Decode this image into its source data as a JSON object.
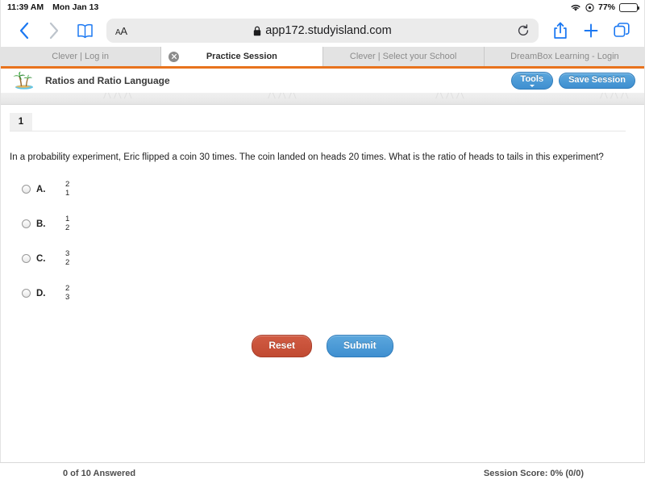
{
  "status_bar": {
    "time": "11:39 AM",
    "date": "Mon Jan 13",
    "battery_percent": "77%",
    "wifi_icon": "wifi-icon",
    "location_icon": "location-icon",
    "battery_icon": "battery-icon"
  },
  "browser": {
    "back_icon": "chevron-left-icon",
    "forward_icon": "chevron-right-icon",
    "bookmarks_icon": "book-icon",
    "text_size_label": "AA",
    "lock_icon": "lock-icon",
    "url": "app172.studyisland.com",
    "reload_icon": "reload-icon",
    "share_icon": "share-icon",
    "new_tab_icon": "plus-icon",
    "tabs_overview_icon": "tabs-icon",
    "tabs": [
      {
        "label": "Clever | Log in",
        "active": false,
        "has_close": false
      },
      {
        "label": "Practice Session",
        "active": true,
        "has_close": true,
        "close_icon": "close-circle-icon"
      },
      {
        "label": "Clever | Select your School",
        "active": false,
        "has_close": false
      },
      {
        "label": "DreamBox Learning - Login",
        "active": false,
        "has_close": false
      }
    ]
  },
  "app": {
    "logo_icon": "palm-island-logo-icon",
    "title": "Ratios and Ratio Language",
    "tools_label": "Tools",
    "tools_caret_icon": "caret-down-icon",
    "save_session_label": "Save Session",
    "accent_orange": "#e8731d",
    "accent_blue": "#3f8fd0",
    "accent_red": "#c14a32"
  },
  "question": {
    "number": "1",
    "text": "In a probability experiment, Eric flipped a coin 30 times. The coin landed on heads 20 times. What is the ratio of heads to tails in this experiment?",
    "choices": [
      {
        "letter": "A.",
        "numerator": "2",
        "denominator": "1",
        "selected": false
      },
      {
        "letter": "B.",
        "numerator": "1",
        "denominator": "2",
        "selected": false
      },
      {
        "letter": "C.",
        "numerator": "3",
        "denominator": "2",
        "selected": false
      },
      {
        "letter": "D.",
        "numerator": "2",
        "denominator": "3",
        "selected": false
      }
    ],
    "reset_label": "Reset",
    "submit_label": "Submit"
  },
  "footer": {
    "answered": "0 of 10 Answered",
    "session_score": "Session Score: 0% (0/0)"
  }
}
